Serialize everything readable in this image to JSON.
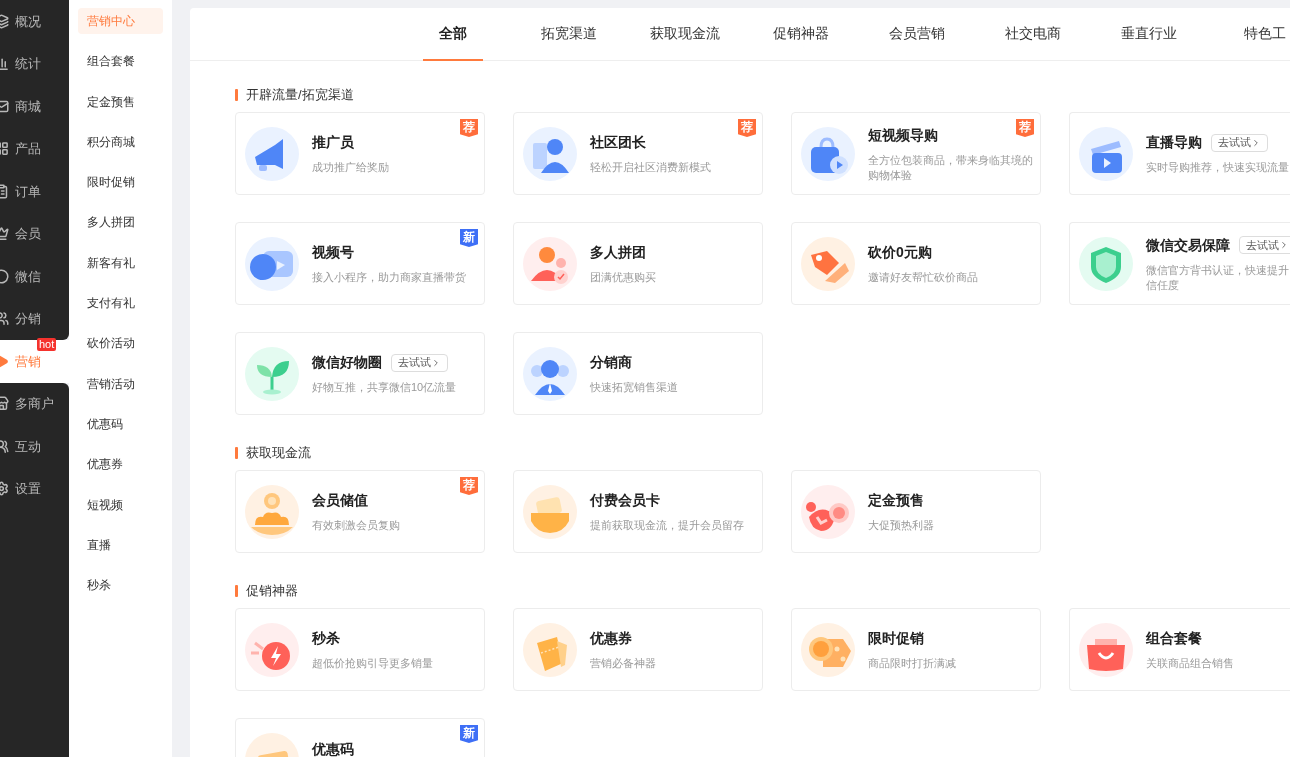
{
  "sidebar": {
    "items": [
      {
        "label": "概况",
        "selected": false
      },
      {
        "label": "统计",
        "selected": false
      },
      {
        "label": "商城",
        "selected": false
      },
      {
        "label": "产品",
        "selected": false
      },
      {
        "label": "订单",
        "selected": false
      },
      {
        "label": "会员",
        "selected": false
      },
      {
        "label": "微信",
        "selected": false
      },
      {
        "label": "分销",
        "selected": false
      },
      {
        "label": "营销",
        "selected": true,
        "badge": "hot"
      },
      {
        "label": "多商户",
        "selected": false
      },
      {
        "label": "互动",
        "selected": false
      },
      {
        "label": "设置",
        "selected": false
      }
    ]
  },
  "submenu": {
    "items": [
      {
        "label": "营销中心",
        "selected": true
      },
      {
        "label": "组合套餐",
        "selected": false
      },
      {
        "label": "定金预售",
        "selected": false
      },
      {
        "label": "积分商城",
        "selected": false
      },
      {
        "label": "限时促销",
        "selected": false
      },
      {
        "label": "多人拼团",
        "selected": false
      },
      {
        "label": "新客有礼",
        "selected": false
      },
      {
        "label": "支付有礼",
        "selected": false
      },
      {
        "label": "砍价活动",
        "selected": false
      },
      {
        "label": "营销活动",
        "selected": false
      },
      {
        "label": "优惠码",
        "selected": false
      },
      {
        "label": "优惠券",
        "selected": false
      },
      {
        "label": "短视频",
        "selected": false
      },
      {
        "label": "直播",
        "selected": false
      },
      {
        "label": "秒杀",
        "selected": false
      }
    ]
  },
  "tabs": [
    {
      "label": "全部",
      "selected": true
    },
    {
      "label": "拓宽渠道",
      "selected": false
    },
    {
      "label": "获取现金流",
      "selected": false
    },
    {
      "label": "促销神器",
      "selected": false
    },
    {
      "label": "会员营销",
      "selected": false
    },
    {
      "label": "社交电商",
      "selected": false
    },
    {
      "label": "垂直行业",
      "selected": false
    },
    {
      "label": "特色工",
      "selected": false
    }
  ],
  "sections": [
    {
      "title": "开辟流量/拓宽渠道",
      "cards": [
        {
          "title": "推广员",
          "description": "成功推广给奖励",
          "tag": {
            "kind": "recommend",
            "text": "荐"
          }
        },
        {
          "title": "社区团长",
          "description": "轻松开启社区消费新模式",
          "tag": {
            "kind": "recommend",
            "text": "荐"
          }
        },
        {
          "title": "短视频导购",
          "description": "全方位包装商品，带来身临其境的购物体验",
          "tag": {
            "kind": "recommend",
            "text": "荐"
          }
        },
        {
          "title": "直播导购",
          "description": "实时导购推荐，快速实现流量",
          "try_label": "去试试"
        },
        {
          "title": "视频号",
          "description": "接入小程序，助力商家直播带货",
          "tag": {
            "kind": "new",
            "text": "新"
          }
        },
        {
          "title": "多人拼团",
          "description": "团满优惠购买"
        },
        {
          "title": "砍价0元购",
          "description": "邀请好友帮忙砍价商品"
        },
        {
          "title": "微信交易保障",
          "description": "微信官方背书认证，快速提升信任度",
          "try_label": "去试试"
        },
        {
          "title": "微信好物圈",
          "description": "好物互推，共享微信10亿流量",
          "try_label": "去试试"
        },
        {
          "title": "分销商",
          "description": "快速拓宽销售渠道"
        }
      ]
    },
    {
      "title": "获取现金流",
      "cards": [
        {
          "title": "会员储值",
          "description": "有效刺激会员复购",
          "tag": {
            "kind": "recommend",
            "text": "荐"
          }
        },
        {
          "title": "付费会员卡",
          "description": "提前获取现金流，提升会员留存"
        },
        {
          "title": "定金预售",
          "description": "大促预热利器"
        }
      ]
    },
    {
      "title": "促销神器",
      "cards": [
        {
          "title": "秒杀",
          "description": "超低价抢购引导更多销量"
        },
        {
          "title": "优惠券",
          "description": "营销必备神器"
        },
        {
          "title": "限时促销",
          "description": "商品限时打折满减"
        },
        {
          "title": "组合套餐",
          "description": "关联商品组合销售"
        },
        {
          "title": "优惠码",
          "tag": {
            "kind": "new",
            "text": "新"
          }
        }
      ]
    }
  ]
}
